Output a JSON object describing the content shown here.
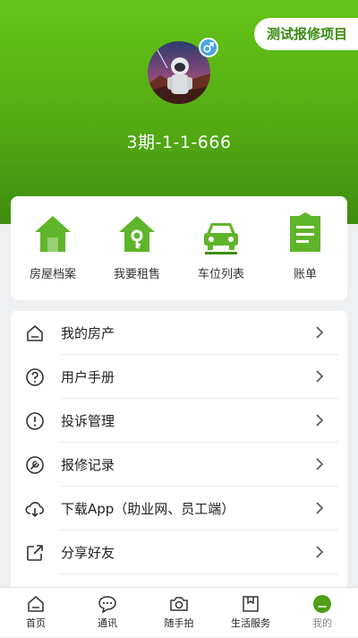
{
  "header": {
    "project_button": "测试报修项目",
    "room": "3期-1-1-666"
  },
  "quick_actions": [
    {
      "label": "房屋档案",
      "icon": "house-icon"
    },
    {
      "label": "我要租售",
      "icon": "house-key-icon"
    },
    {
      "label": "车位列表",
      "icon": "car-icon"
    },
    {
      "label": "账单",
      "icon": "bill-icon"
    }
  ],
  "menu": [
    {
      "label": "我的房产",
      "icon": "home-outline-icon"
    },
    {
      "label": "用户手册",
      "icon": "help-icon"
    },
    {
      "label": "投诉管理",
      "icon": "alert-icon"
    },
    {
      "label": "报修记录",
      "icon": "repair-icon"
    },
    {
      "label": "下载App（助业网、员工端）",
      "icon": "download-cloud-icon"
    },
    {
      "label": "分享好友",
      "icon": "share-icon"
    }
  ],
  "tabbar": [
    {
      "label": "首页",
      "icon": "home-tab-icon"
    },
    {
      "label": "通讯",
      "icon": "chat-icon"
    },
    {
      "label": "随手拍",
      "icon": "camera-icon"
    },
    {
      "label": "生活服务",
      "icon": "bookmark-icon"
    },
    {
      "label": "我的",
      "icon": "profile-icon",
      "active": true
    }
  ],
  "colors": {
    "brand_green": "#52a812",
    "accent_text": "#3b8a10",
    "gender_badge": "#4aa3e8"
  }
}
